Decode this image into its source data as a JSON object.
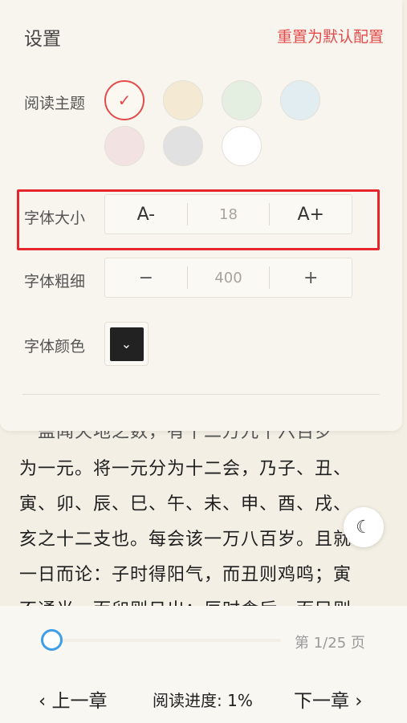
{
  "status": {
    "time": "",
    "icons": "◆ ▮"
  },
  "settings": {
    "title": "设置",
    "reset_label": "重置为默认配置",
    "theme": {
      "label": "阅读主题",
      "swatches": [
        {
          "color": "#fbf8f1",
          "selected": true
        },
        {
          "color": "#f4ead3"
        },
        {
          "color": "#e4efe2"
        },
        {
          "color": "#e2edf1"
        },
        {
          "color": "#f2e3e2"
        },
        {
          "color": "#e1e1e1"
        },
        {
          "color": "#ffffff"
        }
      ],
      "check_icon": "✓"
    },
    "font_size": {
      "label": "字体大小",
      "decrease": "A-",
      "value": "18",
      "increase": "A+"
    },
    "font_weight": {
      "label": "字体粗细",
      "decrease": "−",
      "value": "400",
      "increase": "+"
    },
    "font_color": {
      "label": "字体颜色",
      "color": "#222222",
      "icon": "⌄"
    }
  },
  "reader": {
    "lines": [
      "　盖闻天地之数，有十二万九千六百岁",
      "为一元。将一元分为十二会，乃子、丑、",
      "寅、卯、辰、巳、午、未、申、酉、戌、",
      "亥之十二支也。每会该一万八百岁。且就",
      "一日而论：子时得阳气，而丑则鸡鸣；寅",
      "不通光，而卯则日出；辰时食后，而巳则"
    ],
    "night_icon": "☾"
  },
  "bottom": {
    "page_indicator": "第 1/25 页",
    "prev_label": "‹ 上一章",
    "progress_label": "阅读进度: 1%",
    "next_label": "下一章 ›",
    "progress": 0.01
  },
  "colors": {
    "accent": "#e44a4a",
    "highlight": "#e5262d",
    "slider": "#3f9ee8"
  }
}
